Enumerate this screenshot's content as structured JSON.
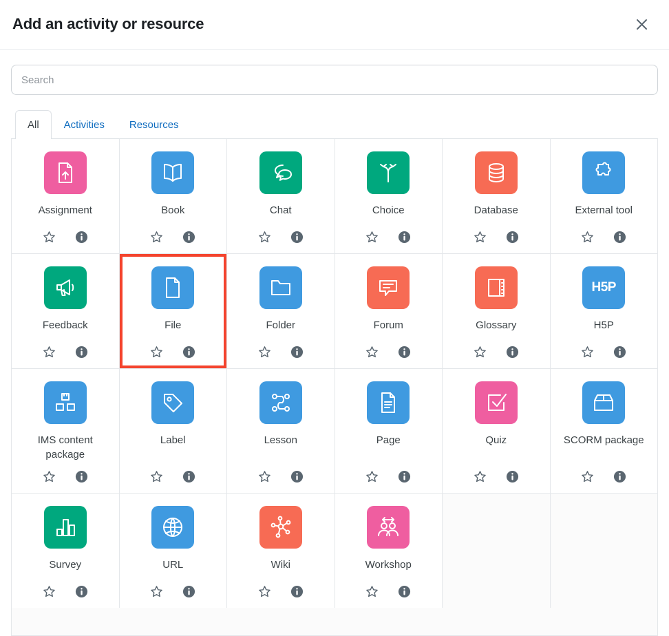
{
  "header": {
    "title": "Add an activity or resource",
    "close_label": "×"
  },
  "search": {
    "placeholder": "Search",
    "value": ""
  },
  "tabs": [
    {
      "label": "All",
      "active": true
    },
    {
      "label": "Activities",
      "active": false
    },
    {
      "label": "Resources",
      "active": false
    }
  ],
  "tile_actions": {
    "favourite_label": "Star",
    "info_label": "Information"
  },
  "colors": {
    "pink": "#ef5ea0",
    "blue": "#3f9ae0",
    "green": "#00a87e",
    "orange": "#f76b54",
    "highlight": "#f4442e",
    "tab_link": "#0f6cbf"
  },
  "items": [
    {
      "label": "Assignment",
      "icon": "assignment-icon",
      "color": "#ef5ea0",
      "highlighted": false
    },
    {
      "label": "Book",
      "icon": "book-icon",
      "color": "#3f9ae0",
      "highlighted": false
    },
    {
      "label": "Chat",
      "icon": "chat-icon",
      "color": "#00a87e",
      "highlighted": false
    },
    {
      "label": "Choice",
      "icon": "choice-icon",
      "color": "#00a87e",
      "highlighted": false
    },
    {
      "label": "Database",
      "icon": "database-icon",
      "color": "#f76b54",
      "highlighted": false
    },
    {
      "label": "External tool",
      "icon": "puzzle-icon",
      "color": "#3f9ae0",
      "highlighted": false
    },
    {
      "label": "Feedback",
      "icon": "megaphone-icon",
      "color": "#00a87e",
      "highlighted": false
    },
    {
      "label": "File",
      "icon": "file-icon",
      "color": "#3f9ae0",
      "highlighted": true
    },
    {
      "label": "Folder",
      "icon": "folder-icon",
      "color": "#3f9ae0",
      "highlighted": false
    },
    {
      "label": "Forum",
      "icon": "forum-icon",
      "color": "#f76b54",
      "highlighted": false
    },
    {
      "label": "Glossary",
      "icon": "glossary-icon",
      "color": "#f76b54",
      "highlighted": false
    },
    {
      "label": "H5P",
      "icon": "h5p-icon",
      "color": "#3f9ae0",
      "highlighted": false
    },
    {
      "label": "IMS content package",
      "icon": "ims-package-icon",
      "color": "#3f9ae0",
      "highlighted": false
    },
    {
      "label": "Label",
      "icon": "tag-icon",
      "color": "#3f9ae0",
      "highlighted": false
    },
    {
      "label": "Lesson",
      "icon": "lesson-path-icon",
      "color": "#3f9ae0",
      "highlighted": false
    },
    {
      "label": "Page",
      "icon": "page-icon",
      "color": "#3f9ae0",
      "highlighted": false
    },
    {
      "label": "Quiz",
      "icon": "quiz-check-icon",
      "color": "#ef5ea0",
      "highlighted": false
    },
    {
      "label": "SCORM package",
      "icon": "scorm-box-icon",
      "color": "#3f9ae0",
      "highlighted": false
    },
    {
      "label": "Survey",
      "icon": "survey-chart-icon",
      "color": "#00a87e",
      "highlighted": false
    },
    {
      "label": "URL",
      "icon": "globe-icon",
      "color": "#3f9ae0",
      "highlighted": false
    },
    {
      "label": "Wiki",
      "icon": "wiki-network-icon",
      "color": "#f76b54",
      "highlighted": false
    },
    {
      "label": "Workshop",
      "icon": "workshop-icon",
      "color": "#ef5ea0",
      "highlighted": false
    }
  ]
}
